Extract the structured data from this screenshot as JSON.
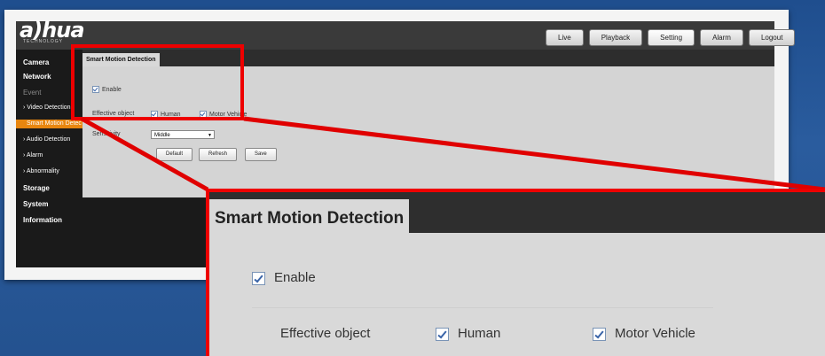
{
  "brand": {
    "logo": "a)hua",
    "sub": "TECHNOLOGY"
  },
  "nav_tabs": [
    {
      "label": "Live",
      "active": false
    },
    {
      "label": "Playback",
      "active": false
    },
    {
      "label": "Setting",
      "active": true
    },
    {
      "label": "Alarm",
      "active": false
    },
    {
      "label": "Logout",
      "active": false
    }
  ],
  "menu": {
    "camera": "Camera",
    "network": "Network",
    "event": "Event",
    "video_detection": "› Video Detection",
    "smart_motion": "Smart Motion Detec",
    "audio_detection": "› Audio Detection",
    "alarm": "› Alarm",
    "abnormality": "› Abnormality",
    "storage": "Storage",
    "system": "System",
    "information": "Information"
  },
  "panel": {
    "tab_title": "Smart Motion Detection",
    "enable_label": "Enable",
    "enable_checked": true,
    "effective_object_label": "Effective object",
    "human_label": "Human",
    "human_checked": true,
    "motor_vehicle_label": "Motor Vehicle",
    "motor_vehicle_checked": true,
    "sensitivity_label": "Sensitivity",
    "sensitivity_value": "Middle",
    "default_button": "Default",
    "refresh_button": "Refresh",
    "save_button": "Save"
  },
  "zoom": {
    "tab_title": "Smart Motion Detection",
    "enable_label": "Enable",
    "effective_object_label": "Effective object",
    "human_label": "Human",
    "motor_vehicle_label": "Motor Vehicle"
  },
  "colors": {
    "highlight": "#e8860f",
    "callout": "#e00000",
    "background": "#24528f"
  }
}
